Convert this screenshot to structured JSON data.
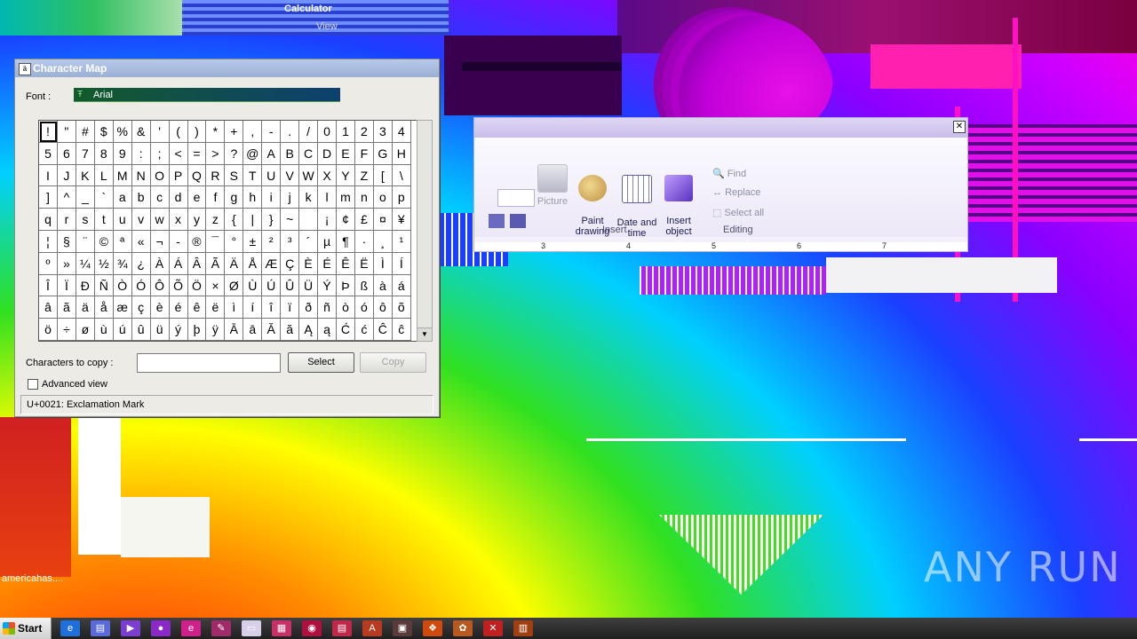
{
  "desktop": {
    "accent_colors": [
      "#ff1010",
      "#ffff00",
      "#30e020",
      "#00d0ff",
      "#8a00ff",
      "#ff00e0"
    ],
    "watermark": "ANY RUN",
    "background_window_title": "Calculator",
    "background_window_menu": "View",
    "desktop_icon_label": "americahas...."
  },
  "paint_ribbon": {
    "buttons": [
      {
        "label": "Picture",
        "icon": "picture-icon",
        "enabled": false
      },
      {
        "label": "Paint\ndrawing",
        "icon": "paint-palette-icon",
        "enabled": true
      },
      {
        "label": "Date and\ntime",
        "icon": "calendar-clock-icon",
        "enabled": true
      },
      {
        "label": "Insert\nobject",
        "icon": "insert-object-icon",
        "enabled": true
      }
    ],
    "editing": [
      "Find",
      "Replace",
      "Select all"
    ],
    "groups": [
      "Insert",
      "Editing"
    ],
    "ruler_marks": [
      "3",
      "4",
      "5",
      "6",
      "7"
    ]
  },
  "charmap": {
    "title": "Character Map",
    "font_label": "Font :",
    "font_value": "Arial",
    "grid": [
      [
        "!",
        "\"",
        "#",
        "$",
        "%",
        "&",
        "'",
        "(",
        ")",
        "*",
        "+",
        ",",
        "-",
        ".",
        "/",
        "0",
        "1",
        "2",
        "3",
        "4"
      ],
      [
        "5",
        "6",
        "7",
        "8",
        "9",
        ":",
        ";",
        "<",
        "=",
        ">",
        "?",
        "@",
        "A",
        "B",
        "C",
        "D",
        "E",
        "F",
        "G",
        "H"
      ],
      [
        "I",
        "J",
        "K",
        "L",
        "M",
        "N",
        "O",
        "P",
        "Q",
        "R",
        "S",
        "T",
        "U",
        "V",
        "W",
        "X",
        "Y",
        "Z",
        "[",
        "\\"
      ],
      [
        "]",
        "^",
        "_",
        "`",
        "a",
        "b",
        "c",
        "d",
        "e",
        "f",
        "g",
        "h",
        "i",
        "j",
        "k",
        "l",
        "m",
        "n",
        "o",
        "p"
      ],
      [
        "q",
        "r",
        "s",
        "t",
        "u",
        "v",
        "w",
        "x",
        "y",
        "z",
        "{",
        "|",
        "}",
        "~",
        " ",
        "¡",
        "¢",
        "£",
        "¤",
        "¥"
      ],
      [
        "¦",
        "§",
        "¨",
        "©",
        "ª",
        "«",
        "¬",
        "-",
        "®",
        "¯",
        "°",
        "±",
        "²",
        "³",
        "´",
        "µ",
        "¶",
        "·",
        "¸",
        "¹"
      ],
      [
        "º",
        "»",
        "¼",
        "½",
        "¾",
        "¿",
        "À",
        "Á",
        "Â",
        "Ã",
        "Ä",
        "Å",
        "Æ",
        "Ç",
        "È",
        "É",
        "Ê",
        "Ë",
        "Ì",
        "Í"
      ],
      [
        "Î",
        "Ï",
        "Ð",
        "Ñ",
        "Ò",
        "Ó",
        "Ô",
        "Õ",
        "Ö",
        "×",
        "Ø",
        "Ù",
        "Ú",
        "Û",
        "Ü",
        "Ý",
        "Þ",
        "ß",
        "à",
        "á"
      ],
      [
        "â",
        "ã",
        "ä",
        "å",
        "æ",
        "ç",
        "è",
        "é",
        "ê",
        "ë",
        "ì",
        "í",
        "î",
        "ï",
        "ð",
        "ñ",
        "ò",
        "ó",
        "ô",
        "õ"
      ],
      [
        "ö",
        "÷",
        "ø",
        "ù",
        "ú",
        "û",
        "ü",
        "ý",
        "þ",
        "ÿ",
        "Ā",
        "ā",
        "Ă",
        "ă",
        "Ą",
        "ą",
        "Ć",
        "ć",
        "Ĉ",
        "ĉ"
      ]
    ],
    "selected_char": "!",
    "copy_label": "Characters to copy :",
    "copy_value": "",
    "select_button": "Select",
    "copy_button": "Copy",
    "advanced_view_label": "Advanced view",
    "advanced_view_checked": false,
    "status": "U+0021: Exclamation Mark"
  },
  "taskbar": {
    "start_label": "Start",
    "items": [
      {
        "icon": "ie-icon",
        "glyph": "e",
        "color": "#1e6fd9"
      },
      {
        "icon": "folder-icon",
        "glyph": "▤",
        "color": "#5a6ad8"
      },
      {
        "icon": "media-player-icon",
        "glyph": "▶",
        "color": "#7a3fd0"
      },
      {
        "icon": "record-icon",
        "glyph": "●",
        "color": "#8a28c8"
      },
      {
        "icon": "edge-icon",
        "glyph": "e",
        "color": "#d0208a"
      },
      {
        "icon": "tools-icon",
        "glyph": "✎",
        "color": "#a02a6a"
      },
      {
        "icon": "notepad-icon",
        "glyph": "▭",
        "color": "#d8d0e8"
      },
      {
        "icon": "calculator-icon",
        "glyph": "▦",
        "color": "#c83068"
      },
      {
        "icon": "charmap-icon",
        "glyph": "◉",
        "color": "#b01040"
      },
      {
        "icon": "document-icon",
        "glyph": "▤",
        "color": "#c0284a"
      },
      {
        "icon": "font-icon",
        "glyph": "A",
        "color": "#b83a20"
      },
      {
        "icon": "screen-icon",
        "glyph": "▣",
        "color": "#5a3a3a"
      },
      {
        "icon": "windows-icon",
        "glyph": "❖",
        "color": "#d04a10"
      },
      {
        "icon": "paint-icon",
        "glyph": "✿",
        "color": "#b85a20"
      },
      {
        "icon": "error-icon",
        "glyph": "✕",
        "color": "#c02020"
      },
      {
        "icon": "archive-icon",
        "glyph": "▥",
        "color": "#a04010"
      }
    ]
  }
}
